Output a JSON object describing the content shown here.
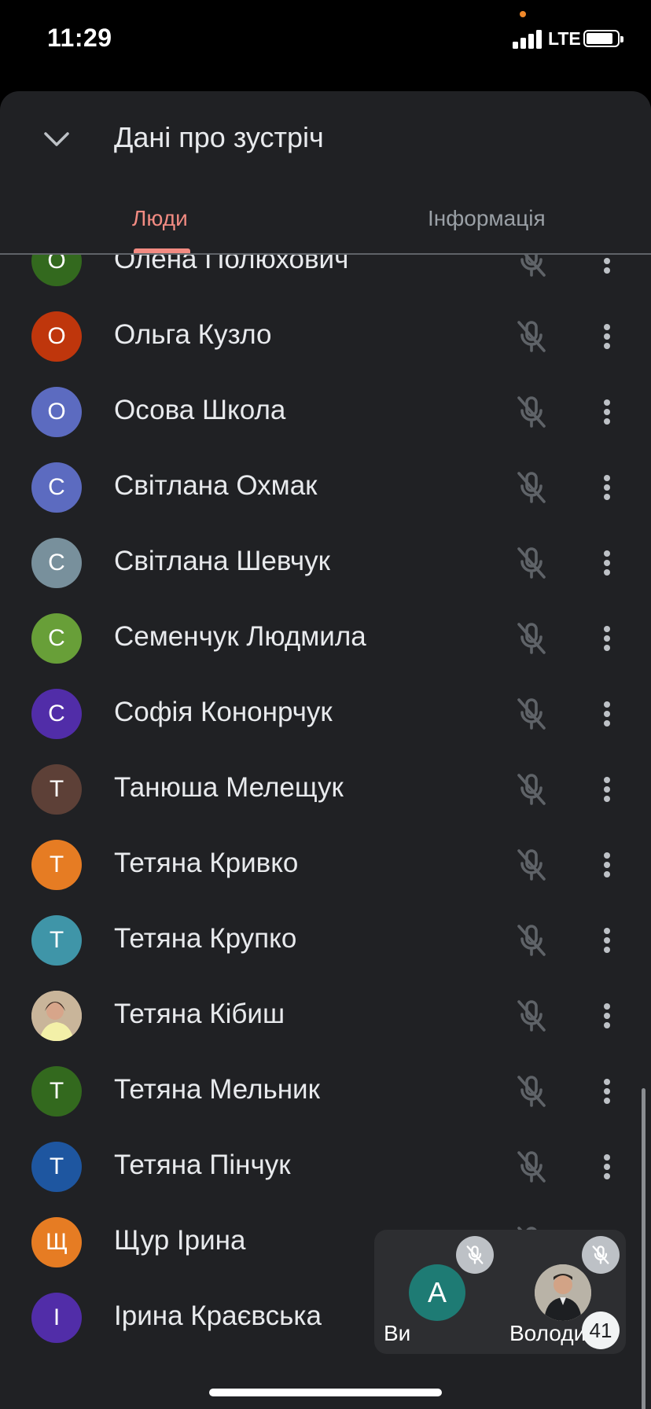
{
  "status_bar": {
    "time": "11:29",
    "network": "LTE"
  },
  "sheet": {
    "title": "Дані про зустріч",
    "tabs": [
      {
        "label": "Люди",
        "active": true
      },
      {
        "label": "Інформація",
        "active": false
      }
    ]
  },
  "participants": [
    {
      "initial": "О",
      "name": "Олена Полюхович",
      "avatar_color": "#33691e",
      "muted": true
    },
    {
      "initial": "О",
      "name": "Ольга Кузло",
      "avatar_color": "#bf360c",
      "muted": true
    },
    {
      "initial": "О",
      "name": "Осова Школа",
      "avatar_color": "#5c6bc0",
      "muted": true
    },
    {
      "initial": "С",
      "name": "Світлана Охмак",
      "avatar_color": "#5c6bc0",
      "muted": true
    },
    {
      "initial": "С",
      "name": "Світлана Шевчук",
      "avatar_color": "#78909c",
      "muted": true
    },
    {
      "initial": "С",
      "name": "Семенчук Людмила",
      "avatar_color": "#689f38",
      "muted": true
    },
    {
      "initial": "С",
      "name": "Софія Кононрчук",
      "avatar_color": "#512da8",
      "muted": true
    },
    {
      "initial": "Т",
      "name": "Танюша Мелещук",
      "avatar_color": "#5d4037",
      "muted": true
    },
    {
      "initial": "Т",
      "name": "Тетяна Кривко",
      "avatar_color": "#e67c23",
      "muted": true
    },
    {
      "initial": "Т",
      "name": "Тетяна Крупко",
      "avatar_color": "#3f95a8",
      "muted": true
    },
    {
      "initial": "",
      "name": "Тетяна Кібиш",
      "avatar_color": "#c9b59a",
      "photo": true,
      "muted": true
    },
    {
      "initial": "Т",
      "name": "Тетяна Мельник",
      "avatar_color": "#33691e",
      "muted": true
    },
    {
      "initial": "Т",
      "name": "Тетяна Пінчук",
      "avatar_color": "#1e56a0",
      "muted": true
    },
    {
      "initial": "Щ",
      "name": "Щур Ірина",
      "avatar_color": "#e67c23",
      "muted": true
    },
    {
      "initial": "І",
      "name": "Ірина Краєвська",
      "avatar_color": "#512da8",
      "muted": true
    }
  ],
  "pip": {
    "self_initial": "А",
    "self_label": "Ви",
    "other_label": "Володи",
    "participant_count": "41"
  },
  "colors": {
    "accent": "#f28b82",
    "sheet_bg": "#202124",
    "text": "#e8eaed"
  }
}
